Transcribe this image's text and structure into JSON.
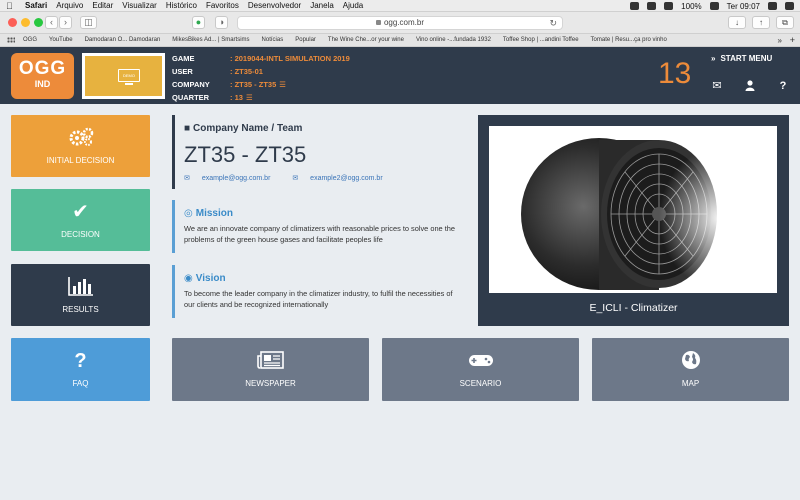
{
  "menubar": {
    "app": "Safari",
    "items": [
      "Arquivo",
      "Editar",
      "Visualizar",
      "Histórico",
      "Favoritos",
      "Desenvolvedor",
      "Janela",
      "Ajuda"
    ],
    "battery": "100%",
    "clock": "Ter 09:07"
  },
  "browser": {
    "url": "ogg.com.br",
    "favorites": [
      "OGG",
      "YouTube",
      "Damodaran O... Damodaran",
      "MikesBikes Ad... | Smartsims",
      "Notícias",
      "Popular",
      "The Wine Che...or your wine",
      "Vino online -...fundada 1932",
      "Toffee Shop | ...andini Toffee",
      "Tomate | Resu...ça pro vinho"
    ]
  },
  "header": {
    "logo_top": "OGG",
    "logo_bottom": "IND",
    "demo_label": "DEMO",
    "rows": [
      {
        "key": "GAME",
        "value": ": 2019044-INTL SIMULATION 2019"
      },
      {
        "key": "USER",
        "value": ": ZT35-01"
      },
      {
        "key": "COMPANY",
        "value": ": ZT35 - ZT35"
      },
      {
        "key": "QUARTER",
        "value": ": 13"
      }
    ],
    "quarter_number": "13",
    "start_menu": "START MENU"
  },
  "tiles": {
    "initial_decision": "INITIAL DECISION",
    "decision": "DECISION",
    "results": "RESULTS",
    "faq": "FAQ",
    "newspaper": "NEWSPAPER",
    "scenario": "SCENARIO",
    "map": "MAP"
  },
  "company": {
    "heading": "Company Name / Team",
    "name": "ZT35 - ZT35",
    "email1": "example@ogg.com.br",
    "email2": "example2@ogg.com.br",
    "mission_title": "Mission",
    "mission_text": "We are an innovate company of climatizers with reasonable prices to solve one the problems of the green house gases and facilitate peoples life",
    "vision_title": "Vision",
    "vision_text": "To become the leader company in the climatizer industry, to fulfil the necessities of our clients and be recognized internationally"
  },
  "product": {
    "caption": "E_ICLI - Climatizer"
  },
  "colors": {
    "navy": "#2f3b4b",
    "orange": "#ed8b3a",
    "teal": "#55bd98",
    "blue": "#4e9cd8",
    "slate": "#6d7889"
  }
}
